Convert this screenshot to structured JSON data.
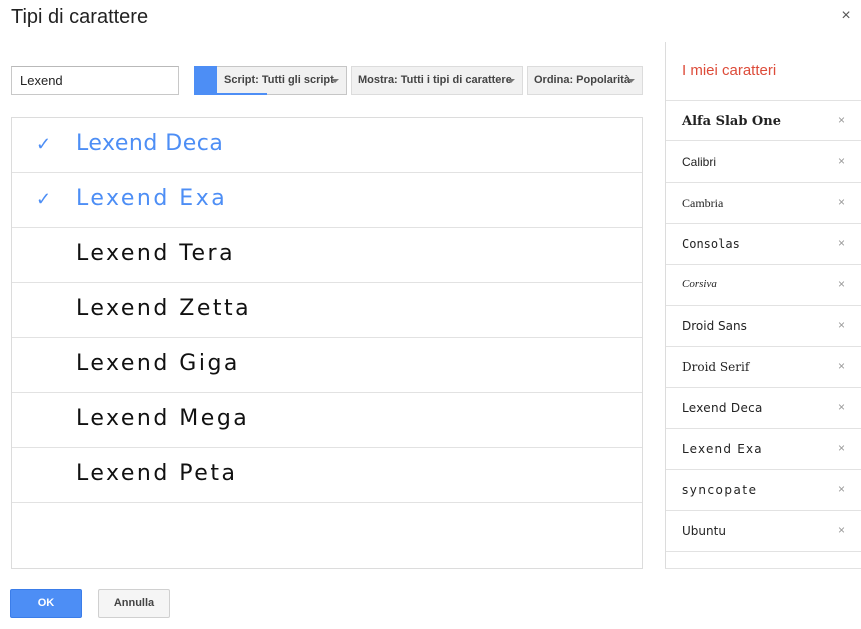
{
  "dialog": {
    "title": "Tipi di carattere",
    "close_glyph": "×"
  },
  "search": {
    "value": "Lexend"
  },
  "filters": {
    "script_label": "Script: Tutti gli script",
    "mostra_label": "Mostra: Tutti i tipi di carattere",
    "ordina_label": "Ordina: Popolarità",
    "accent": "#4d8ef5"
  },
  "font_list": [
    {
      "name": "Lexend Deca",
      "selected": true
    },
    {
      "name": "Lexend Exa",
      "selected": true
    },
    {
      "name": "Lexend Tera",
      "selected": false
    },
    {
      "name": "Lexend Zetta",
      "selected": false
    },
    {
      "name": "Lexend Giga",
      "selected": false
    },
    {
      "name": "Lexend Mega",
      "selected": false
    },
    {
      "name": "Lexend Peta",
      "selected": false
    }
  ],
  "check_glyph": "✓",
  "my_fonts": {
    "title": "I miei caratteri",
    "remove_glyph": "×",
    "items": [
      {
        "name": "Alfa Slab One"
      },
      {
        "name": "Calibri"
      },
      {
        "name": "Cambria"
      },
      {
        "name": "Consolas"
      },
      {
        "name": "Corsiva"
      },
      {
        "name": "Droid Sans"
      },
      {
        "name": "Droid Serif"
      },
      {
        "name": "Lexend Deca"
      },
      {
        "name": "Lexend Exa"
      },
      {
        "name": "Syncopate"
      },
      {
        "name": "Ubuntu"
      }
    ]
  },
  "buttons": {
    "ok": "OK",
    "cancel": "Annulla"
  },
  "colors": {
    "primary": "#4d8ef5",
    "title_red": "#dd4b39"
  }
}
